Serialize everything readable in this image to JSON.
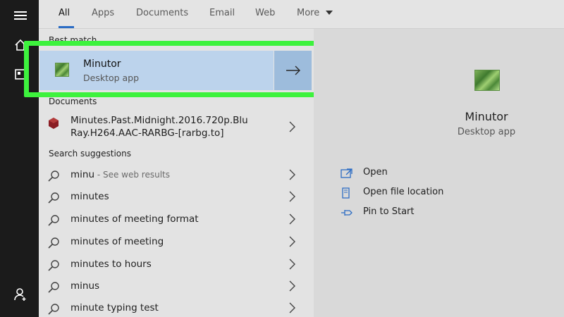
{
  "tabs": [
    {
      "label": "All",
      "active": true
    },
    {
      "label": "Apps"
    },
    {
      "label": "Documents"
    },
    {
      "label": "Email"
    },
    {
      "label": "Web"
    },
    {
      "label": "More"
    }
  ],
  "sections": {
    "best_match": "Best match",
    "documents": "Documents",
    "search_suggestions": "Search suggestions"
  },
  "best_match": {
    "name": "Minutor",
    "type": "Desktop app"
  },
  "document": {
    "line1": "Minutes.Past.Midnight.2016.720p.Blu",
    "line2": "Ray.H264.AAC-RARBG-[rarbg.to]"
  },
  "suggestions": [
    {
      "text": "minu",
      "sub": " - See web results"
    },
    {
      "text": "minutes"
    },
    {
      "text": "minutes of meeting format"
    },
    {
      "text": "minutes of meeting"
    },
    {
      "text": "minutes to hours"
    },
    {
      "text": "minus"
    },
    {
      "text": "minute typing test"
    }
  ],
  "preview": {
    "name": "Minutor",
    "type": "Desktop app"
  },
  "actions": [
    {
      "label": "Open",
      "icon": "open-icon"
    },
    {
      "label": "Open file location",
      "icon": "file-location-icon"
    },
    {
      "label": "Pin to Start",
      "icon": "pin-icon"
    }
  ],
  "colors": {
    "highlight": "#3df23d",
    "best_match_bg": "#bcd3ec",
    "accent": "#2b6cc4"
  }
}
